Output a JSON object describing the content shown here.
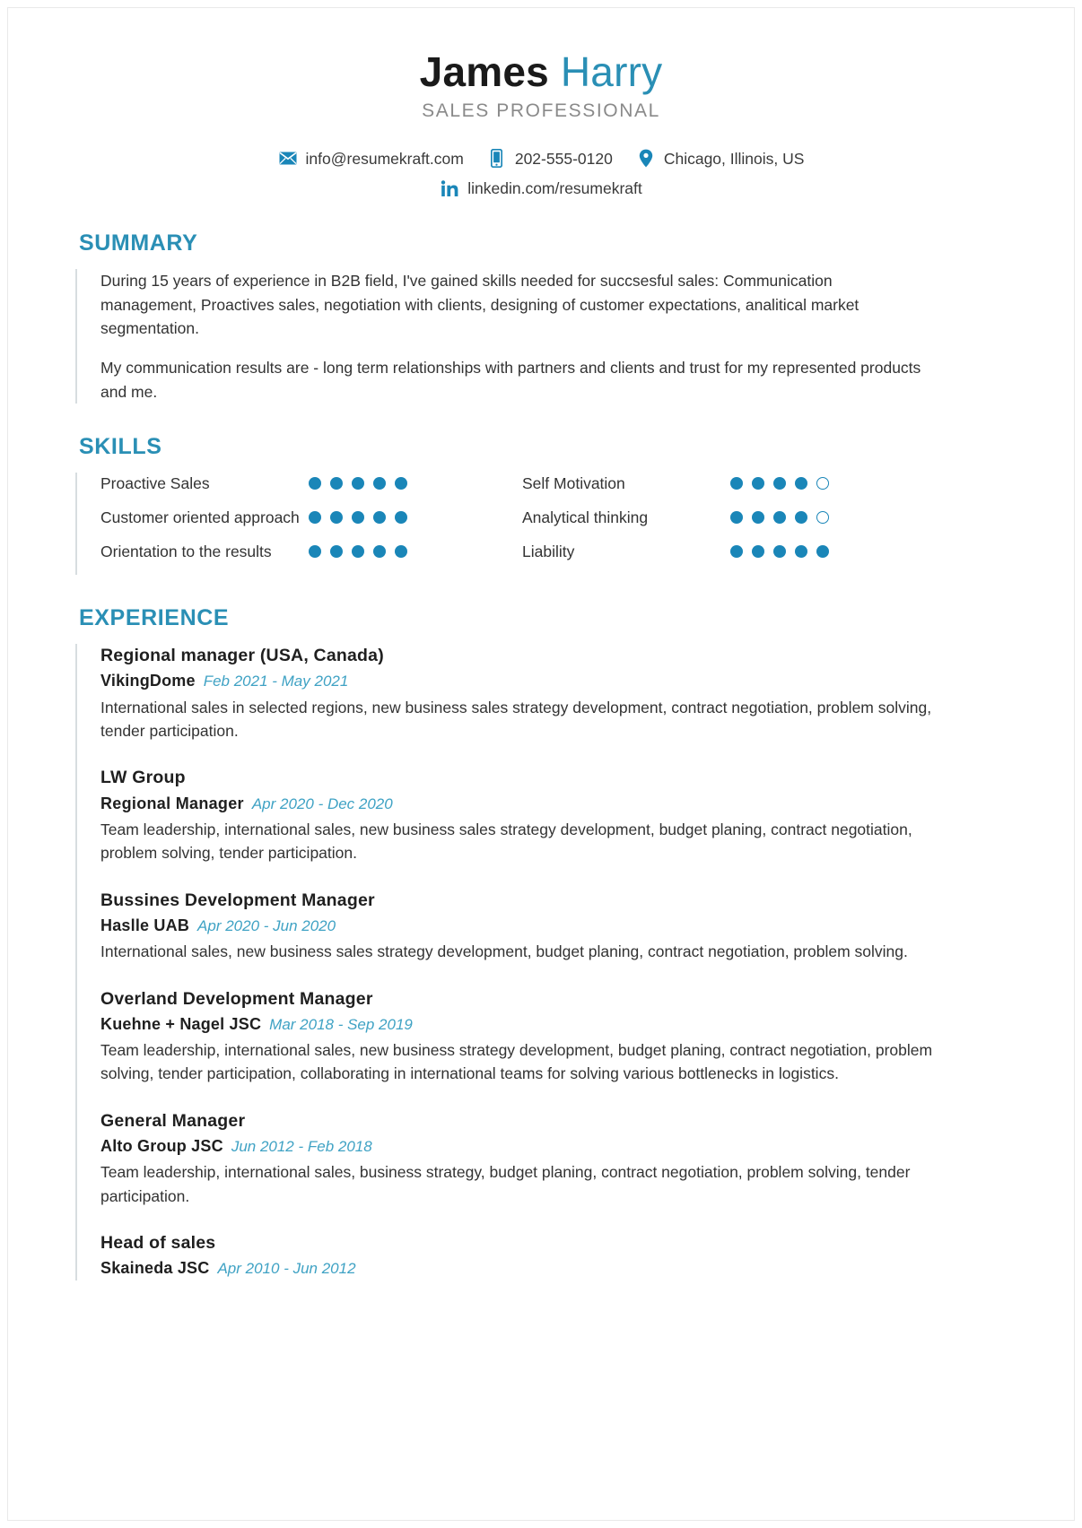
{
  "header": {
    "first_name": "James",
    "last_name": "Harry",
    "job_title": "SALES PROFESSIONAL",
    "contacts_line1": [
      {
        "icon": "email-icon",
        "value": "info@resumekraft.com"
      },
      {
        "icon": "phone-icon",
        "value": "202-555-0120"
      },
      {
        "icon": "location-pin-icon",
        "value": "Chicago, Illinois, US"
      }
    ],
    "contacts_line2": [
      {
        "icon": "linkedin-icon",
        "value": "linkedin.com/resumekraft"
      }
    ]
  },
  "sections": {
    "summary": {
      "title": "SUMMARY",
      "paragraphs": [
        "During 15 years of experience in B2B field, I've gained skills needed for succsesful sales: Communication management, Proactives sales, negotiation with clients, designing of customer expectations, analitical market segmentation.",
        "My communication results are - long term relationships with partners and clients and trust for my represented products and me."
      ]
    },
    "skills": {
      "title": "SKILLS",
      "left_column": [
        {
          "label": "Proactive Sales",
          "rating": 5,
          "max": 5
        },
        {
          "label": "Customer oriented approach",
          "rating": 5,
          "max": 5
        },
        {
          "label": "Orientation to the results",
          "rating": 5,
          "max": 5
        }
      ],
      "right_column": [
        {
          "label": "Self Motivation",
          "rating": 4,
          "max": 5
        },
        {
          "label": "Analytical thinking",
          "rating": 4,
          "max": 5
        },
        {
          "label": "Liability",
          "rating": 5,
          "max": 5
        }
      ]
    },
    "experience": {
      "title": "EXPERIENCE",
      "items": [
        {
          "role": "Regional manager (USA, Canada)",
          "company": "VikingDome",
          "dates": "Feb 2021 - May 2021",
          "description": "International sales in selected regions, new business sales strategy development, contract negotiation, problem solving, tender participation.",
          "layout": "role-first"
        },
        {
          "company_heading": "LW Group",
          "subrole": "Regional Manager",
          "dates": "Apr 2020 - Dec 2020",
          "description": "Team leadership, international sales, new business sales strategy development, budget planing, contract negotiation, problem solving, tender participation.",
          "layout": "company-first"
        },
        {
          "role": "Bussines Development Manager",
          "company": "Haslle UAB",
          "dates": "Apr 2020 - Jun 2020",
          "description": "International sales, new business sales strategy development, budget planing, contract negotiation, problem solving.",
          "layout": "role-first"
        },
        {
          "role": "Overland Development Manager",
          "company": "Kuehne + Nagel JSC",
          "dates": "Mar 2018 - Sep 2019",
          "description": "Team leadership, international sales, new business strategy development, budget planing, contract negotiation, problem solving, tender participation, collaborating in international teams for solving various bottlenecks in logistics.",
          "layout": "role-first"
        },
        {
          "role": "General Manager",
          "company": "Alto Group JSC",
          "dates": "Jun 2012 - Feb 2018",
          "description": "Team leadership, international sales, business strategy, budget planing, contract negotiation, problem solving, tender participation.",
          "layout": "role-first"
        },
        {
          "role": "Head of sales",
          "company": "Skaineda JSC",
          "dates": "Apr 2010 - Jun 2012",
          "description": "",
          "layout": "role-first"
        }
      ]
    }
  },
  "colors": {
    "accent": "#2a8fb5",
    "dot": "#1a86b8",
    "date_text": "#3fa2c4",
    "subtitle": "#8a8a8a",
    "body_text": "#333333"
  }
}
